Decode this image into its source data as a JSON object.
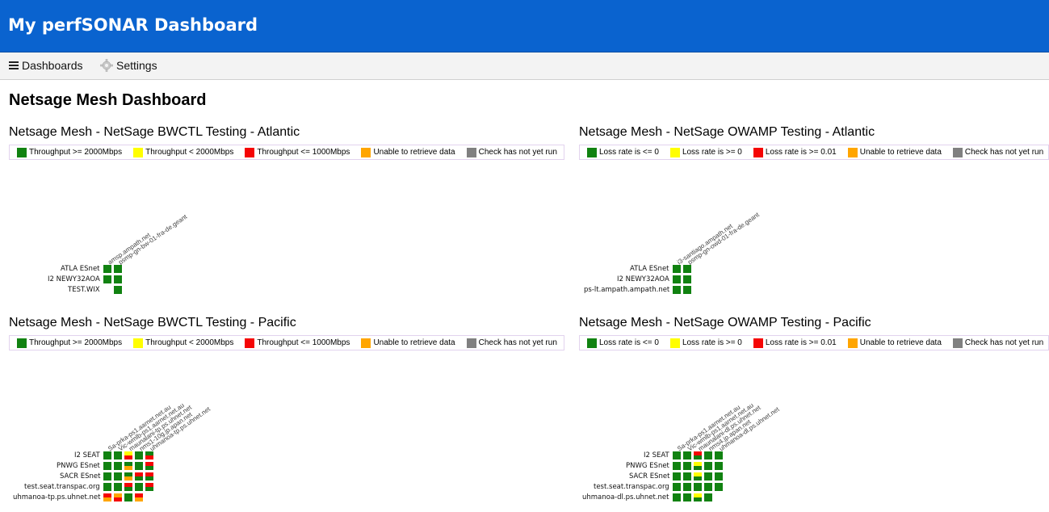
{
  "app": {
    "title": "My perfSONAR Dashboard"
  },
  "nav": {
    "dashboards_label": "Dashboards",
    "settings_label": "Settings"
  },
  "page": {
    "title": "Netsage Mesh Dashboard"
  },
  "colors": {
    "header_bg": "#0a63cf",
    "green": "#118211",
    "yellow": "#fffe00",
    "red": "#f50505",
    "orange": "#ffa500",
    "gray": "#808080"
  },
  "sections": [
    {
      "title": "Netsage Mesh - NetSage BWCTL Testing - Atlantic",
      "legend": [
        {
          "label": "Throughput >= 2000Mbps",
          "color": "#118211"
        },
        {
          "label": "Throughput < 2000Mbps",
          "color": "#fffe00"
        },
        {
          "label": "Throughput <= 1000Mbps",
          "color": "#f50505"
        },
        {
          "label": "Unable to retrieve data",
          "color": "#ffa500"
        },
        {
          "label": "Check has not yet run",
          "color": "#808080"
        }
      ],
      "columns": [
        "amsp.ampath.net",
        "psmp-gn-bw-01-fra-de.geant"
      ],
      "rows": [
        {
          "label": "ATLA ESnet",
          "cells": [
            "g",
            "g"
          ]
        },
        {
          "label": "I2 NEWY32AOA",
          "cells": [
            "g",
            "g"
          ]
        },
        {
          "label": "TEST.WIX",
          "cells": [
            "",
            "g"
          ]
        }
      ]
    },
    {
      "title": "Netsage Mesh - NetSage OWAMP Testing - Atlantic",
      "legend": [
        {
          "label": "Loss rate is <= 0",
          "color": "#118211"
        },
        {
          "label": "Loss rate is >= 0",
          "color": "#fffe00"
        },
        {
          "label": "Loss rate is >= 0.01",
          "color": "#f50505"
        },
        {
          "label": "Unable to retrieve data",
          "color": "#ffa500"
        },
        {
          "label": "Check has not yet run",
          "color": "#808080"
        }
      ],
      "columns": [
        "i3-santiago.ampath.net",
        "psmp-gn-owd-01-fra-de.geant"
      ],
      "rows": [
        {
          "label": "ATLA ESnet",
          "cells": [
            "g",
            "g"
          ]
        },
        {
          "label": "I2 NEWY32AOA",
          "cells": [
            "g",
            "g"
          ]
        },
        {
          "label": "ps-lt.ampath.ampath.net",
          "cells": [
            "g",
            "g"
          ]
        }
      ]
    },
    {
      "title": "Netsage Mesh - NetSage BWCTL Testing - Pacific",
      "legend": [
        {
          "label": "Throughput >= 2000Mbps",
          "color": "#118211"
        },
        {
          "label": "Throughput < 2000Mbps",
          "color": "#fffe00"
        },
        {
          "label": "Throughput <= 1000Mbps",
          "color": "#f50505"
        },
        {
          "label": "Unable to retrieve data",
          "color": "#ffa500"
        },
        {
          "label": "Check has not yet run",
          "color": "#808080"
        }
      ],
      "columns": [
        "Sa-prka-ps1.aarnet.net.au",
        "Vic-wmlb-ps1.aarnet.net.au",
        "maunalani-tp.ps.uhnet.net",
        "nms1-10g.jp.apan.net",
        "uhmanoa-tp.ps.uhnet.net"
      ],
      "rows": [
        {
          "label": "I2 SEAT",
          "cells": [
            "g",
            "g",
            "y/r",
            "g",
            "g/r"
          ]
        },
        {
          "label": "PNWG ESnet",
          "cells": [
            "g",
            "g",
            "g/o",
            "g",
            "r/g"
          ]
        },
        {
          "label": "SACR ESnet",
          "cells": [
            "g",
            "g",
            "g/o",
            "r/g",
            "r/g"
          ]
        },
        {
          "label": "test.seat.transpac.org",
          "cells": [
            "g",
            "g",
            "r/g",
            "g",
            "r/g"
          ]
        },
        {
          "label": "uhmanoa-tp.ps.uhnet.net",
          "cells": [
            "r/o",
            "o/r",
            "g",
            "r/o",
            ""
          ]
        }
      ]
    },
    {
      "title": "Netsage Mesh - NetSage OWAMP Testing - Pacific",
      "legend": [
        {
          "label": "Loss rate is <= 0",
          "color": "#118211"
        },
        {
          "label": "Loss rate is >= 0",
          "color": "#fffe00"
        },
        {
          "label": "Loss rate is >= 0.01",
          "color": "#f50505"
        },
        {
          "label": "Unable to retrieve data",
          "color": "#ffa500"
        },
        {
          "label": "Check has not yet run",
          "color": "#808080"
        }
      ],
      "columns": [
        "Sa-prka-ps1.aarnet.net.au",
        "Vic-wmlb-ps1.aarnet.net.au",
        "maunalani-dl.ps.uhnet.net",
        "nms4.jp.apan.net",
        "uhmanoa-dl.ps.uhnet.net"
      ],
      "rows": [
        {
          "label": "I2 SEAT",
          "cells": [
            "g",
            "g",
            "r/g",
            "g",
            "g"
          ]
        },
        {
          "label": "PNWG ESnet",
          "cells": [
            "g",
            "g",
            "y/g",
            "g",
            "g"
          ]
        },
        {
          "label": "SACR ESnet",
          "cells": [
            "g",
            "g",
            "y/g",
            "g",
            "g"
          ]
        },
        {
          "label": "test.seat.transpac.org",
          "cells": [
            "g",
            "g",
            "g",
            "g",
            "g"
          ]
        },
        {
          "label": "uhmanoa-dl.ps.uhnet.net",
          "cells": [
            "g",
            "g",
            "y/g",
            "g",
            ""
          ]
        }
      ]
    }
  ]
}
